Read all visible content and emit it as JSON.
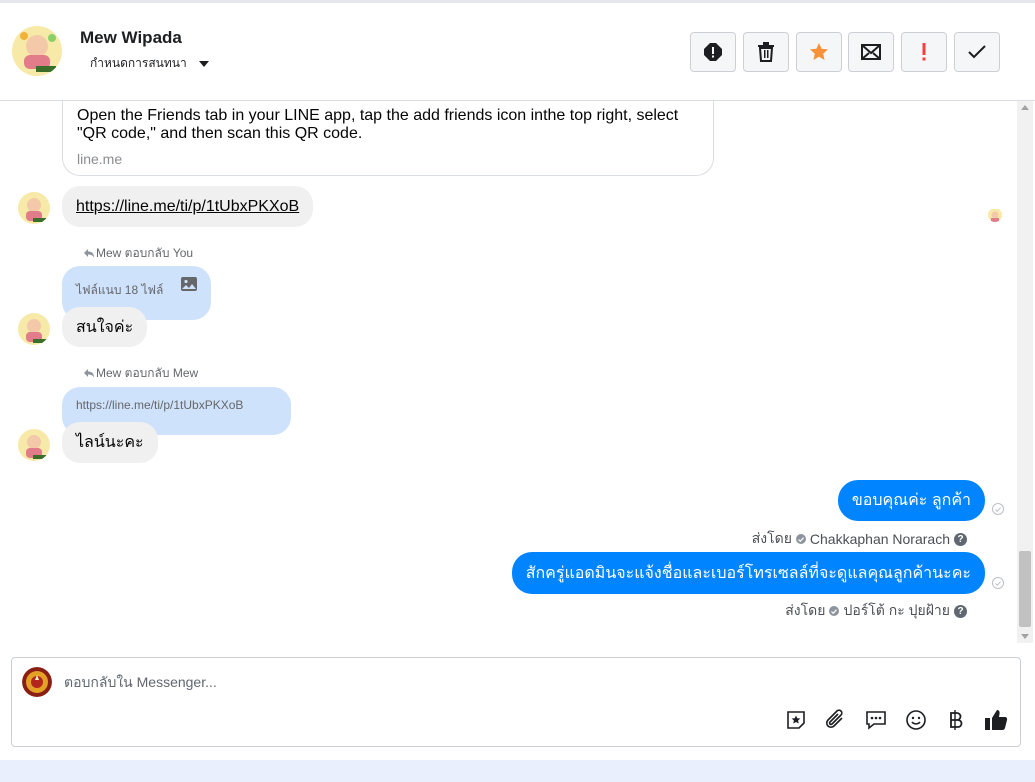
{
  "header": {
    "name": "Mew Wipada",
    "subtitle": "กำหนดการสนทนา",
    "buttons": [
      {
        "name": "alert-icon",
        "color": "#1c1e21"
      },
      {
        "name": "trash-icon",
        "color": "#1c1e21"
      },
      {
        "name": "star-icon",
        "color": "#f7923b"
      },
      {
        "name": "envelope-icon",
        "color": "#1c1e21"
      },
      {
        "name": "exclamation-icon",
        "color": "#fa3e3e"
      },
      {
        "name": "check-icon",
        "color": "#1c1e21"
      }
    ]
  },
  "messages": {
    "link_card": {
      "description": "Open the Friends tab in your LINE app, tap the add friends icon inthe top right, select \"QR code,\" and then scan this QR code.",
      "domain": "line.me"
    },
    "link_message": "https://line.me/ti/p/1tUbxPKXoB",
    "reply1": {
      "note": "Mew ตอบกลับ You",
      "quote": "ไฟล์แนบ 18 ไฟล์",
      "text": "สนใจค่ะ"
    },
    "reply2": {
      "note": "Mew ตอบกลับ Mew",
      "quote": "https://line.me/ti/p/1tUbxPKXoB",
      "text": "ไลน์นะคะ"
    },
    "outgoing1": {
      "text": "ขอบคุณค่ะ ลูกค้า",
      "sent_by_label": "ส่งโดย",
      "sender": "Chakkaphan Norarach"
    },
    "outgoing2": {
      "text": "สักครู่แอดมินจะแจ้งชื่อและเบอร์โทรเซลล์ที่จะดูแลคุณลูกค้านะคะ",
      "sent_by_label": "ส่งโดย",
      "sender": "ปอร์โต้ กะ ปุยฝ้าย"
    }
  },
  "composer": {
    "placeholder": "ตอบกลับใน Messenger...",
    "icons": [
      "sticker-icon",
      "attachment-icon",
      "saved-replies-icon",
      "emoji-icon",
      "baht-icon",
      "like-icon"
    ]
  },
  "colors": {
    "blue_bubble": "#0084ff",
    "quote_bubble": "#cfe2fb",
    "gray_bubble": "#f0f0f0"
  }
}
